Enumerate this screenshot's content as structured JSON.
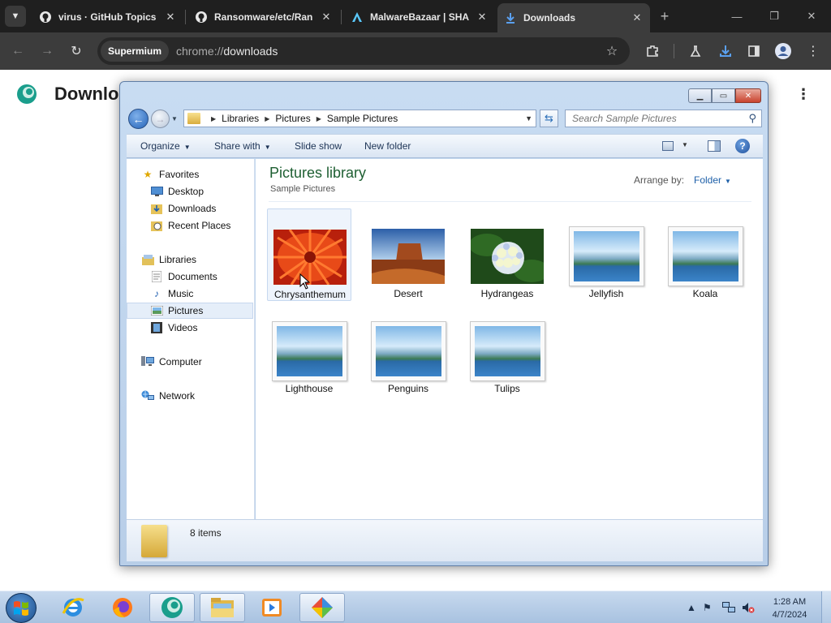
{
  "browser": {
    "tabs": [
      {
        "title": "virus · GitHub Topics",
        "icon": "github-icon",
        "active": false
      },
      {
        "title": "Ransomware/etc/Ran",
        "icon": "github-icon",
        "active": false
      },
      {
        "title": "MalwareBazaar | SHA",
        "icon": "malwarebazaar-icon",
        "active": false
      },
      {
        "title": "Downloads",
        "icon": "download-icon",
        "active": true
      }
    ],
    "site_chip": "Supermium",
    "url_scheme": "chrome://",
    "url_host": "downloads"
  },
  "page": {
    "title": "Downlo"
  },
  "explorer": {
    "breadcrumb": [
      "Libraries",
      "Pictures",
      "Sample Pictures"
    ],
    "search_placeholder": "Search Sample Pictures",
    "commands": {
      "organize": "Organize",
      "share_with": "Share with",
      "slide_show": "Slide show",
      "new_folder": "New folder"
    },
    "nav": {
      "favorites": "Favorites",
      "desktop": "Desktop",
      "downloads": "Downloads",
      "recent_places": "Recent Places",
      "libraries": "Libraries",
      "documents": "Documents",
      "music": "Music",
      "pictures": "Pictures",
      "videos": "Videos",
      "computer": "Computer",
      "network": "Network"
    },
    "library_title": "Pictures library",
    "library_subtitle": "Sample Pictures",
    "arrange_label": "Arrange by:",
    "arrange_value": "Folder",
    "files": [
      {
        "name": "Chrysanthemum",
        "thumb": "chrysanthemum"
      },
      {
        "name": "Desert",
        "thumb": "desert"
      },
      {
        "name": "Hydrangeas",
        "thumb": "hydrangeas"
      },
      {
        "name": "Jellyfish",
        "thumb": "placeholder"
      },
      {
        "name": "Koala",
        "thumb": "placeholder"
      },
      {
        "name": "Lighthouse",
        "thumb": "placeholder"
      },
      {
        "name": "Penguins",
        "thumb": "placeholder"
      },
      {
        "name": "Tulips",
        "thumb": "placeholder"
      }
    ],
    "item_count": "8 items"
  },
  "taskbar": {
    "time": "1:28 AM",
    "date": "4/7/2024"
  },
  "colors": {
    "library_title": "#1e5f32",
    "link_blue": "#1d5fa8",
    "chrome_dark": "#1f1f1f"
  }
}
